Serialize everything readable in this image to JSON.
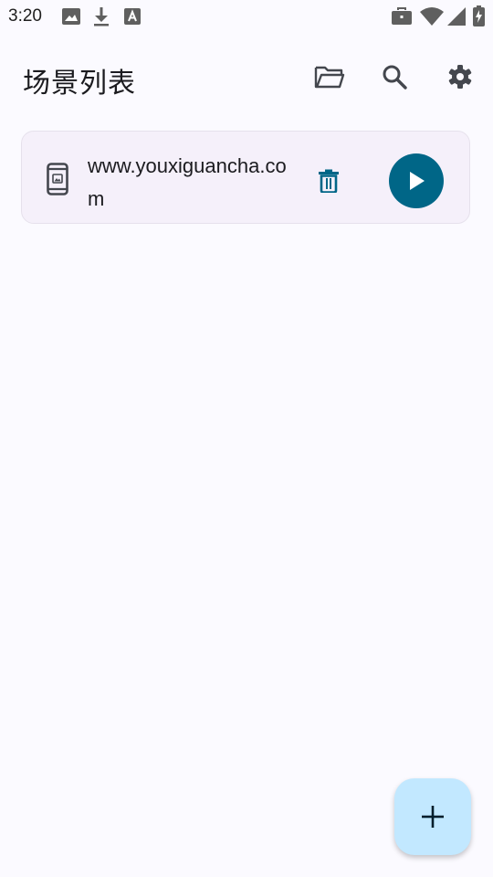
{
  "status_bar": {
    "time": "3:20",
    "left_icons": [
      "image-icon",
      "download-icon",
      "text-a-icon"
    ],
    "right_icons": [
      "work-briefcase-icon",
      "wifi-icon",
      "cell-signal-icon",
      "battery-charging-icon"
    ]
  },
  "app_bar": {
    "title": "场景列表",
    "actions": [
      "folder-icon",
      "search-icon",
      "gear-icon"
    ]
  },
  "scenes": [
    {
      "name": "www.youxiguancha.com",
      "icon": "phone-device-icon"
    }
  ],
  "fab": {
    "icon": "plus-icon"
  },
  "colors": {
    "background": "#fbfaff",
    "card": "#f5f0fa",
    "accent": "#006687",
    "fab": "#c2e8ff"
  }
}
